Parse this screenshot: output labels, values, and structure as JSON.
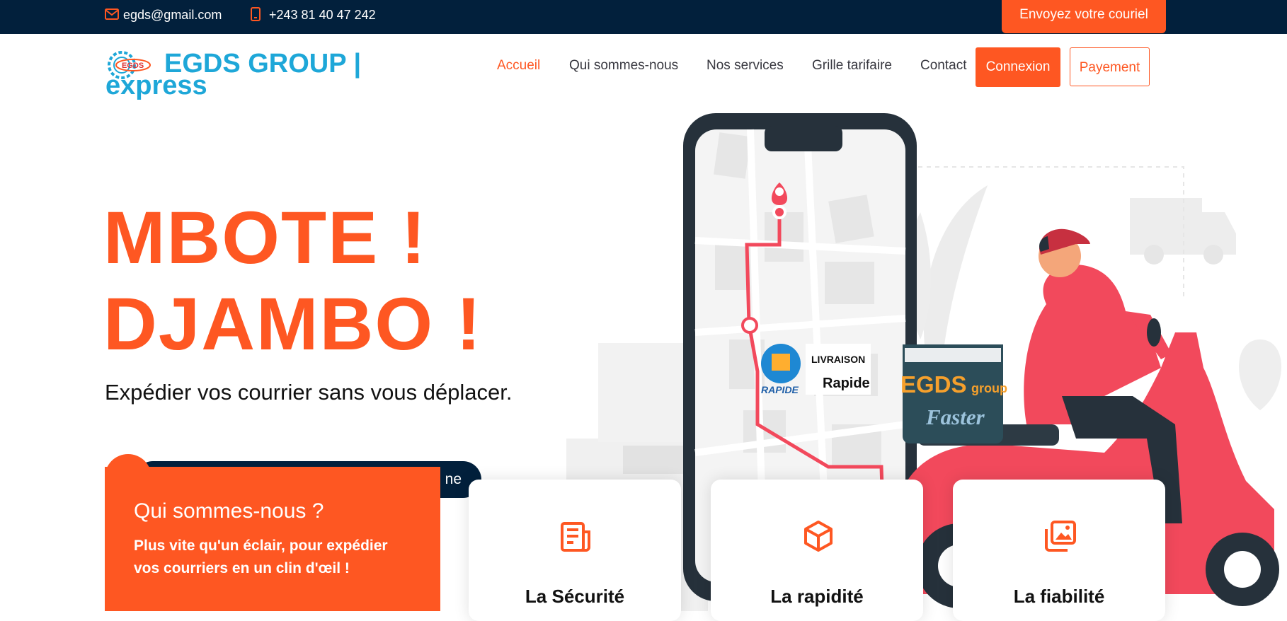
{
  "topbar": {
    "email": "egds@gmail.com",
    "phone": "+243 81 40 47 242",
    "send_label": "Envoyez votre couriel"
  },
  "header": {
    "logo_emblem_text": "EGDS",
    "brand_line1": "EGDS GROUP |",
    "brand_line2": "express",
    "nav": [
      "Accueil",
      "Qui sommes-nous",
      "Nos services",
      "Grille tarifaire",
      "Contact"
    ],
    "login_label": "Connexion",
    "payment_label": "Payement"
  },
  "hero": {
    "title_line1": "MBOTE !",
    "title_line2": "DJAMBO !",
    "subtitle": "Expédier vos courrier sans vous déplacer.",
    "pill_text": "ne"
  },
  "about": {
    "title": "Qui sommes-nous ?",
    "text": "Plus vite qu'un éclair, pour expédier vos courriers en un clin d'œil !"
  },
  "features": [
    {
      "label": "La Sécurité",
      "icon": "newspaper-icon"
    },
    {
      "label": "La rapidité",
      "icon": "cube-icon"
    },
    {
      "label": "La fiabilité",
      "icon": "images-icon"
    }
  ],
  "illustration": {
    "badge1_word1": "LIVRAISON",
    "badge1_word2": "Rapide",
    "badge1_logo": "RAPIDE",
    "box_brand": "EGDS",
    "box_group": "group",
    "box_tagline": "Faster"
  },
  "colors": {
    "accent": "#fe5722",
    "dark_navy": "#02203c",
    "brand_blue": "#1ea7d8",
    "scooter_red": "#f2495c"
  }
}
